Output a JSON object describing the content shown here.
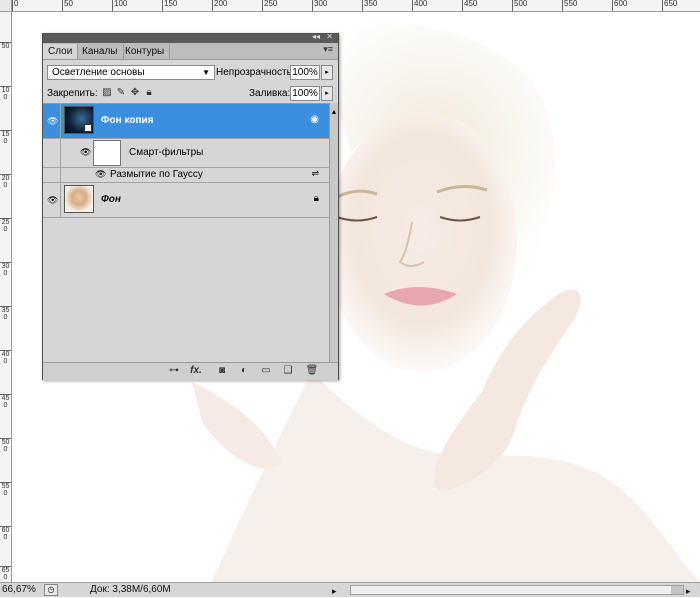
{
  "rulers": {
    "top_labels": [
      "0",
      "50",
      "100",
      "150",
      "200",
      "250",
      "300",
      "350",
      "400",
      "450",
      "500",
      "550",
      "600",
      "650"
    ],
    "left_labels": [
      "50",
      "100",
      "150",
      "200",
      "250",
      "300",
      "350",
      "400",
      "450",
      "500",
      "550",
      "600",
      "650"
    ]
  },
  "layers_panel": {
    "tabs": [
      {
        "label": "Слои",
        "active": true
      },
      {
        "label": "Каналы",
        "active": false
      },
      {
        "label": "Контуры",
        "active": false
      }
    ],
    "collapse_icon": "double-arrow-icon",
    "close_icon": "close-icon",
    "menu_icon": "panel-menu-icon",
    "blend_mode": "Осветление основы",
    "opacity_label": "Непрозрачность:",
    "opacity_value": "100%",
    "lock_label": "Закрепить:",
    "fill_label": "Заливка:",
    "fill_value": "100%",
    "layers": [
      {
        "name": "Фон копия",
        "selected": true,
        "visible": true,
        "badge": "smart-object-icon"
      },
      {
        "name": "Фон",
        "selected": false,
        "visible": true,
        "badge": "lock-icon"
      }
    ],
    "smart_filters_label": "Смарт-фильтры",
    "filter_name": "Размытие по Гауссу",
    "footer_icons": [
      "link-icon",
      "fx-icon",
      "mask-icon",
      "adjustment-icon",
      "folder-icon",
      "new-layer-icon",
      "trash-icon"
    ],
    "fx_label": "fx."
  },
  "statusbar": {
    "zoom": "66,67%",
    "doc_info": "Док: 3,38M/6,60M"
  },
  "colors": {
    "selected_layer": "#3b8ee0",
    "arrow": "#e01010",
    "panel_bg": "#d6d6d6"
  }
}
